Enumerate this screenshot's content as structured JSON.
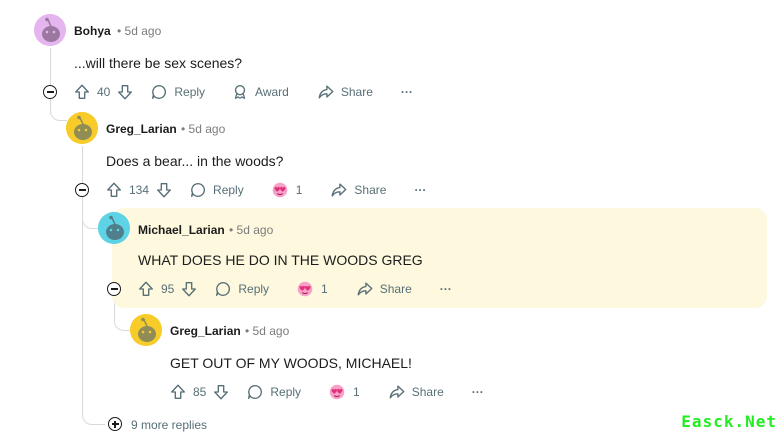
{
  "comments": [
    {
      "username": "Bohya",
      "time": "• 5d ago",
      "text": "...will there be sex scenes?",
      "votes": "40",
      "reply_label": "Reply",
      "award_label": "Award",
      "share_label": "Share",
      "more_label": "···",
      "avatar_color": "#e5b5ef"
    },
    {
      "username": "Greg_Larian",
      "time": "• 5d ago",
      "text": "Does a bear... in the woods?",
      "votes": "134",
      "reply_label": "Reply",
      "award_count": "1",
      "share_label": "Share",
      "more_label": "···",
      "avatar_color": "#f7cc2a"
    },
    {
      "username": "Michael_Larian",
      "time": "• 5d ago",
      "text": "WHAT DOES HE DO IN THE WOODS GREG",
      "votes": "95",
      "reply_label": "Reply",
      "award_count": "1",
      "share_label": "Share",
      "more_label": "···",
      "avatar_color": "#5fd3e6",
      "highlight_color": "#fdf8de"
    },
    {
      "username": "Greg_Larian",
      "time": "• 5d ago",
      "text": "GET OUT OF MY WOODS, MICHAEL!",
      "votes": "85",
      "reply_label": "Reply",
      "award_count": "1",
      "share_label": "Share",
      "more_label": "···",
      "avatar_color": "#f7cc2a"
    }
  ],
  "more_replies": "9 more replies",
  "watermark": "Easck.Net"
}
